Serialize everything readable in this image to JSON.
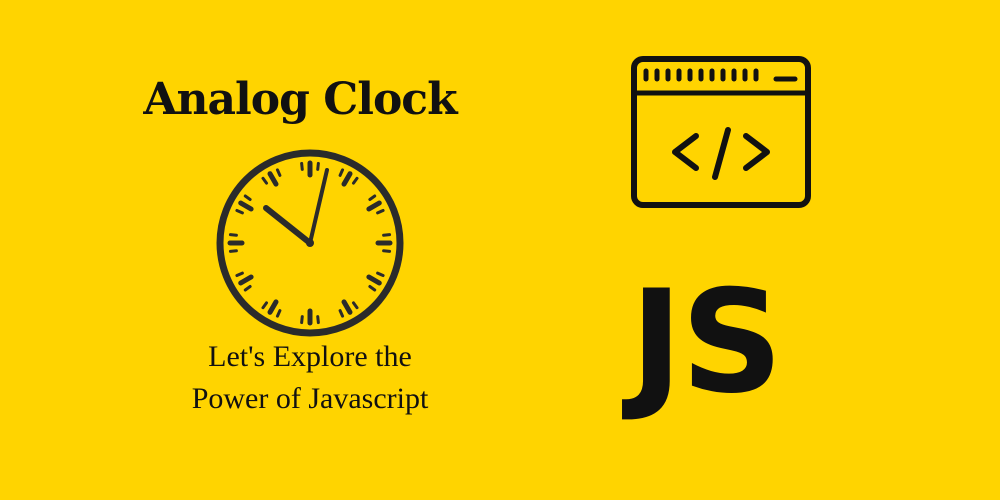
{
  "banner": {
    "background_color": "#ffd400",
    "ink_color": "#111111",
    "title": "Analog Clock",
    "tagline_line1": "Let's Explore the",
    "tagline_line2": "Power of Javascript",
    "js_label": "JS"
  },
  "icons": {
    "clock": "clock-icon",
    "code_window": "code-window-icon"
  }
}
